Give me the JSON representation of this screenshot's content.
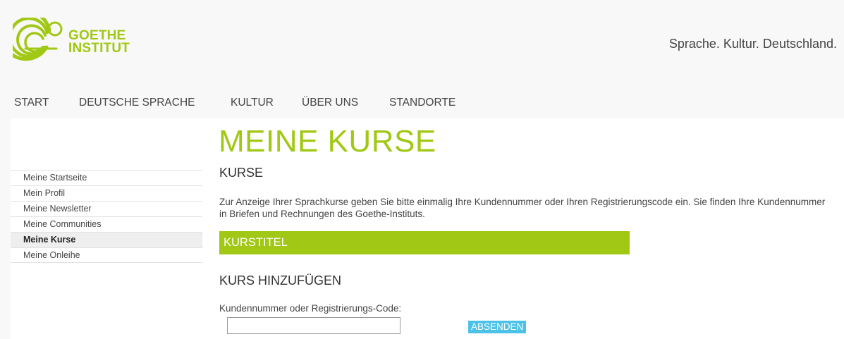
{
  "brand": {
    "logo_line1": "GOETHE",
    "logo_line2": "INSTITUT",
    "tagline": "Sprache. Kultur. Deutschland.",
    "color": "#a0c814"
  },
  "topnav": [
    "START",
    "DEUTSCHE SPRACHE",
    "KULTUR",
    "ÜBER UNS",
    "STANDORTE"
  ],
  "sidebar": {
    "items": [
      {
        "label": "Meine Startseite",
        "active": false
      },
      {
        "label": "Mein Profil",
        "active": false
      },
      {
        "label": "Meine Newsletter",
        "active": false
      },
      {
        "label": "Meine Communities",
        "active": false
      },
      {
        "label": "Meine Kurse",
        "active": true
      },
      {
        "label": "Meine Onleihe",
        "active": false
      }
    ]
  },
  "main": {
    "title": "MEINE KURSE",
    "section_courses": "KURSE",
    "intro": "Zur Anzeige Ihrer Sprachkurse geben Sie bitte einmalig Ihre Kundennummer oder Ihren Registrierungscode ein. Sie finden Ihre Kundennummer in Briefen und Rechnungen des Goethe-Instituts.",
    "course_header": "KURSTITEL",
    "section_add": "KURS HINZUFÜGEN",
    "field_label": "Kundennummer oder Registrierungs-Code:",
    "field_value": "",
    "submit_label": "ABSENDEN",
    "button_color": "#4dc2e8"
  }
}
